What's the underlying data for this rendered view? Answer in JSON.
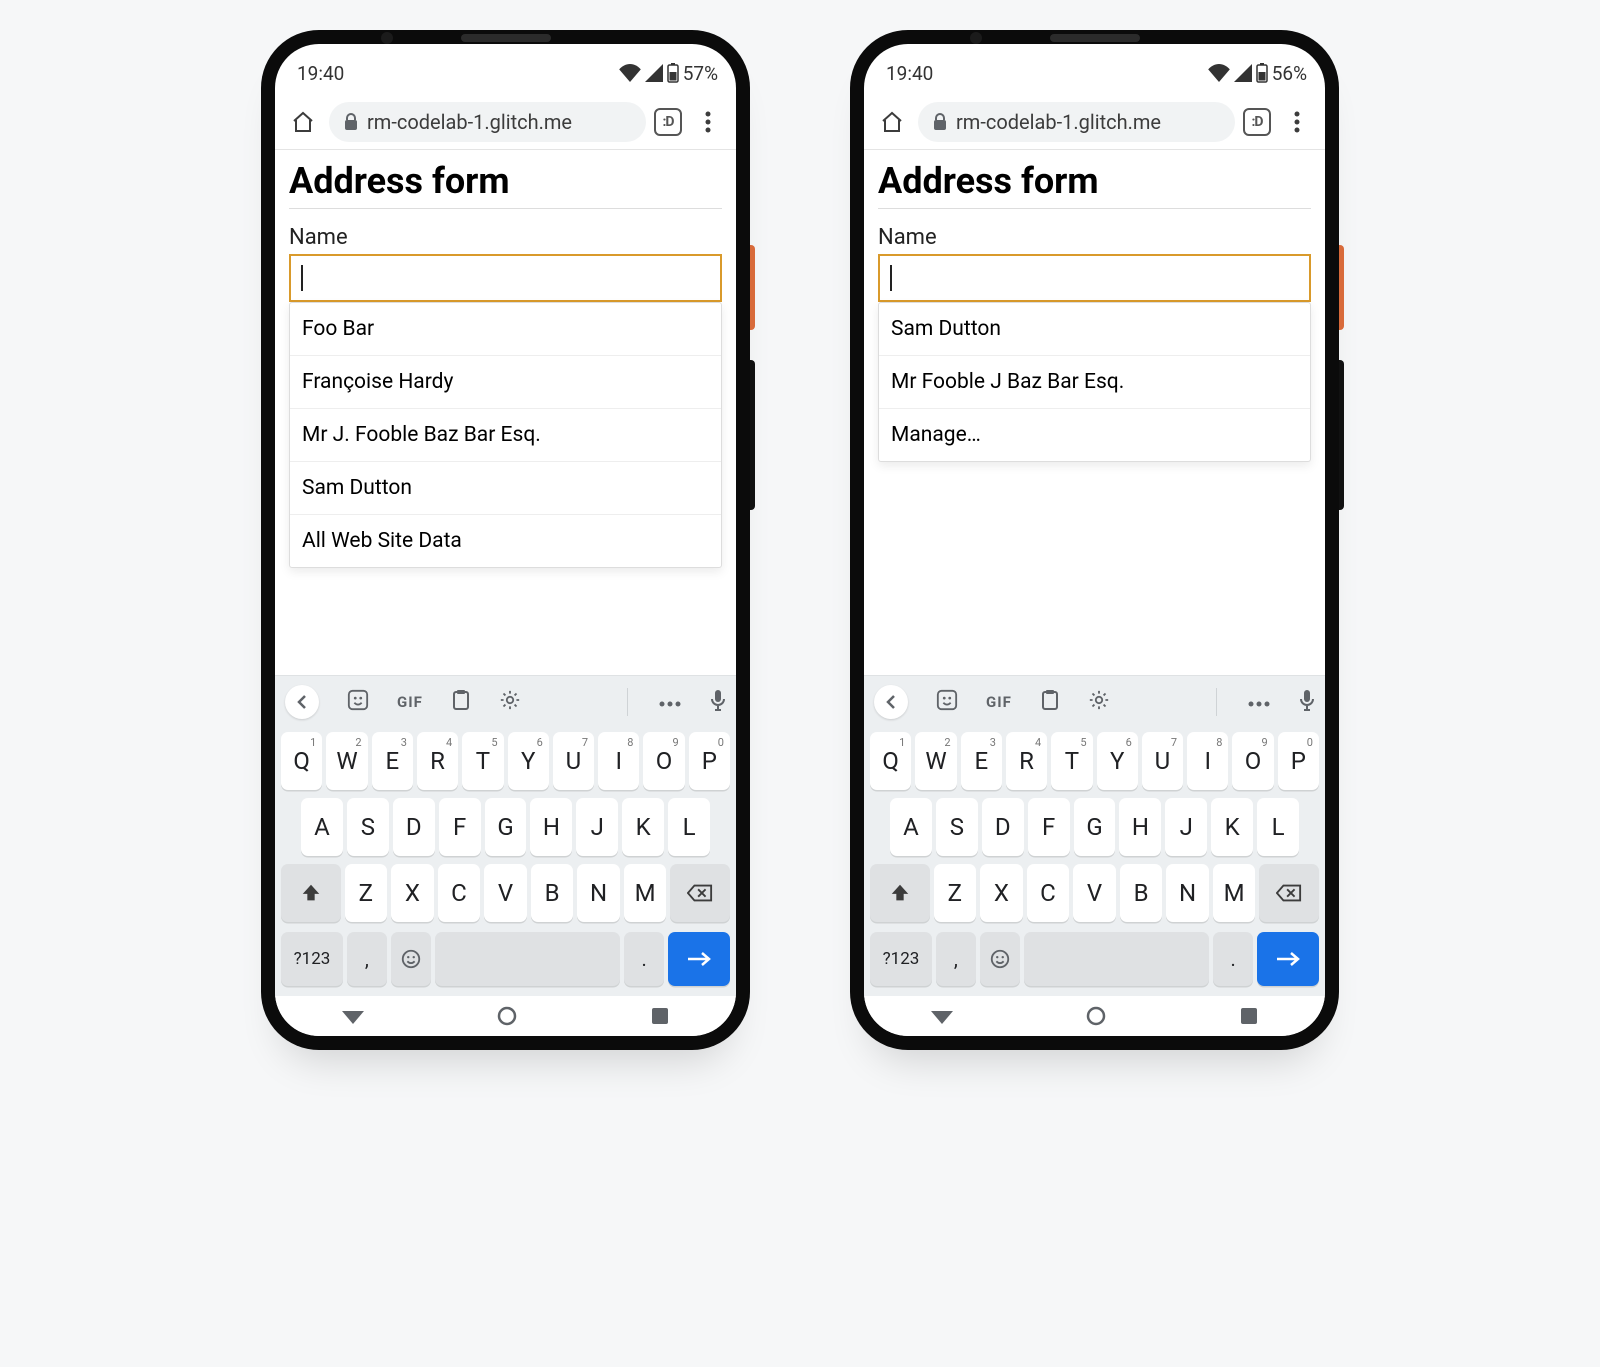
{
  "phones": [
    {
      "status": {
        "time": "19:40",
        "battery": "57%"
      },
      "browser": {
        "url": "rm-codelab-1.glitch.me",
        "tabcount": ":D"
      },
      "page": {
        "title": "Address form",
        "name_label": "Name",
        "name_value": "",
        "suggestions": [
          "Foo Bar",
          "Françoise Hardy",
          "Mr J. Fooble Baz Bar Esq.",
          "Sam Dutton",
          "All Web Site Data"
        ]
      }
    },
    {
      "status": {
        "time": "19:40",
        "battery": "56%"
      },
      "browser": {
        "url": "rm-codelab-1.glitch.me",
        "tabcount": ":D"
      },
      "page": {
        "title": "Address form",
        "name_label": "Name",
        "name_value": "",
        "suggestions": [
          "Sam Dutton",
          "Mr Fooble J Baz Bar Esq.",
          "Manage…"
        ]
      }
    }
  ],
  "keyboard": {
    "toolbar": {
      "gif": "GIF"
    },
    "row1": [
      "Q",
      "W",
      "E",
      "R",
      "T",
      "Y",
      "U",
      "I",
      "O",
      "P"
    ],
    "row1_sup": [
      "1",
      "2",
      "3",
      "4",
      "5",
      "6",
      "7",
      "8",
      "9",
      "0"
    ],
    "row2": [
      "A",
      "S",
      "D",
      "F",
      "G",
      "H",
      "J",
      "K",
      "L"
    ],
    "row3": [
      "Z",
      "X",
      "C",
      "V",
      "B",
      "N",
      "M"
    ],
    "sym": "?123",
    "comma": ",",
    "period": "."
  }
}
